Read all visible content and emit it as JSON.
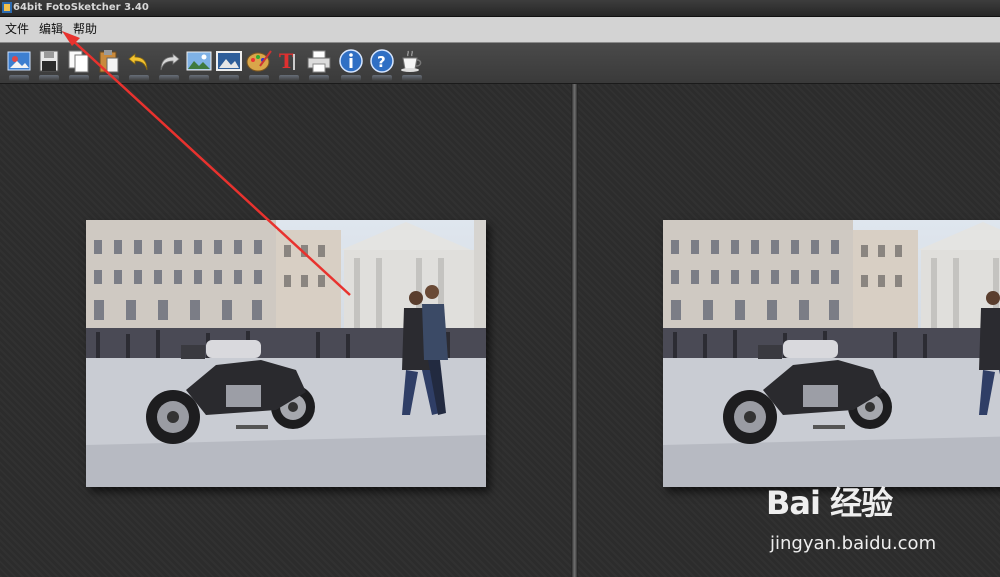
{
  "window": {
    "title": "64bit FotoSketcher 3.40"
  },
  "menu": [
    {
      "label": "文件"
    },
    {
      "label": "编辑"
    },
    {
      "label": "帮助"
    }
  ],
  "toolbar": {
    "buttons": [
      {
        "icon": "open-image-icon"
      },
      {
        "icon": "save-icon"
      },
      {
        "icon": "copy-icon"
      },
      {
        "icon": "paste-icon"
      },
      {
        "icon": "undo-icon"
      },
      {
        "icon": "redo-icon"
      },
      {
        "icon": "image-settings-icon"
      },
      {
        "icon": "frame-icon"
      },
      {
        "icon": "palette-icon"
      },
      {
        "icon": "text-icon"
      },
      {
        "icon": "print-icon"
      },
      {
        "icon": "info-icon"
      },
      {
        "icon": "help-icon"
      },
      {
        "icon": "coffee-icon"
      }
    ]
  },
  "annotation": {
    "arrow_color": "#e8322e"
  },
  "watermark": {
    "brand": "Bai 经验",
    "url": "jingyan.baidu.com"
  }
}
